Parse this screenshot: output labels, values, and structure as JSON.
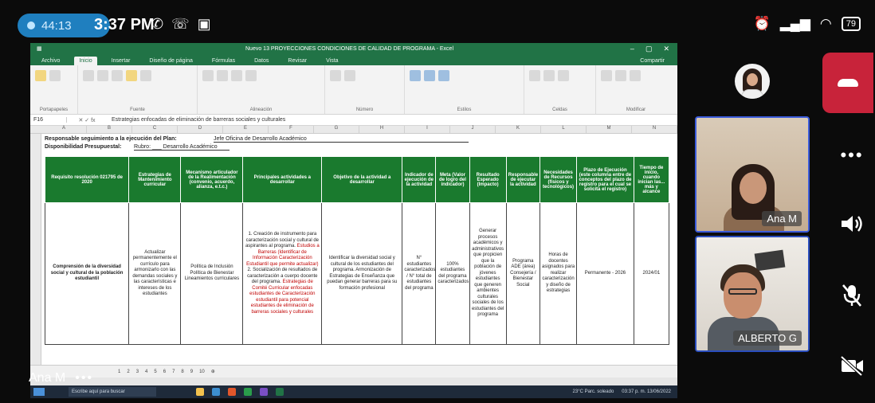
{
  "status_bar": {
    "call_timer": "44:13",
    "clock": "3:37 PM",
    "battery": "79"
  },
  "excel": {
    "window_title": "Nuevo 13 PROYECCIONES CONDICIONES DE CALIDAD DE PROGRAMA - Excel",
    "tabs": [
      "Archivo",
      "Inicio",
      "Insertar",
      "Diseño de página",
      "Fórmulas",
      "Datos",
      "Revisar",
      "Vista"
    ],
    "share_button": "Compartir",
    "ribbon_groups": [
      "Portapapeles",
      "Fuente",
      "Alineación",
      "Número",
      "Estilos",
      "Celdas",
      "Modificar"
    ],
    "name_box": "F16",
    "formula": "Estrategias enfocadas de eliminación de barreras sociales y culturales",
    "columns": [
      "A",
      "B",
      "C",
      "D",
      "E",
      "F",
      "G",
      "H",
      "I",
      "J",
      "K",
      "L",
      "M",
      "N"
    ],
    "responsible_label": "Responsable seguimiento a la ejecución del Plan:",
    "responsible_value": "Jefe Oficina de Desarrollo Académico",
    "budget_label": "Disponibilidad Presupuestal:",
    "budget_value": "Rubro: ___ Desarrollo Académico",
    "headers": [
      "Requisito resolución 021795 de 2020",
      "Estrategias de Mantenimiento curricular",
      "Mecanismo articulador de la Realimentación (convenio, acuerdo, alianza, e.t.c.)",
      "Principales actividades a desarrollar",
      "Objetivo de la actividad a desarrollar",
      "Indicador de ejecución de la actividad",
      "Meta (Valor de logro del indicador)",
      "Resultado Esperado (Impacto)",
      "Responsable de ejecutar la actividad",
      "Necesidades de Recursos (físicos y tecnológicos)",
      "Plazo de Ejecución (este columna entre de conceptos del plazo de registro para el cual se solicita el registro)",
      "Tiempo de inicio, cuando inician las... más y alcance"
    ],
    "row": {
      "requisito": "Comprensión de la diversidad social y cultural de la población estudiantil",
      "estrategias": "Actualizar permanentemente el currículo para armonizarlo con las demandas sociales y las características e intereses de los estudiantes",
      "mecanismo": "Política de Inclusión Política de Bienestar Lineamientos curriculares",
      "actividades_a": "1. Creación de instrumento para caracterización social y cultural de aspirantes al programa.",
      "actividades_a_red": "Estudios a Barreras (Identificar de Información Caracterización Estudiantil que permite actualizar)",
      "actividades_b": "2. Socialización de resultados de caracterización a cuerpo docente del programa.",
      "actividades_b_red": "Estrategias de Comité Curricular enfocadas estudiantes de Caracterización estudiantil para potencial estudiantes de eliminación de barreras sociales y culturales",
      "objetivo": "Identificar la diversidad social y cultural de los estudiantes del programa. Armonización de Estrategias de Enseñanza que puedan generar barreras para su formación profesional",
      "indicador": "N° estudiantes caracterizados / N° total de estudiantes del programa",
      "meta": "100% estudiantes del programa caracterizados",
      "resultado": "Generar procesos académicos y administrativos que propicien que la población de jóvenes estudiantes que generen ambientes culturales sociales de los estudiantes del programa",
      "responsable": "Programa ADE (área) Consejería / Bienestar Social",
      "recursos": "Horas de docentes asignados para realizar caracterización y diseño de estrategias",
      "plazo": "Permanente - 2026",
      "tiempo": "2024/01"
    },
    "sheet_tabs": [
      "1",
      "2",
      "3",
      "4",
      "5",
      "6",
      "7",
      "8",
      "9",
      "10"
    ],
    "taskbar_search": "Escribe aquí para buscar",
    "taskbar_temp": "23°C Parc. soleado",
    "taskbar_time": "03:37 p. m. 13/06/2022"
  },
  "share_label": "Ana M",
  "participants": {
    "tile1_name": "Ana M",
    "tile2_name": "ALBERTO G"
  },
  "colors": {
    "header_green": "#1a7a2e",
    "excel_green": "#217346",
    "end_call_red": "#c8233a",
    "tile_border_blue": "#3b5bdb"
  }
}
